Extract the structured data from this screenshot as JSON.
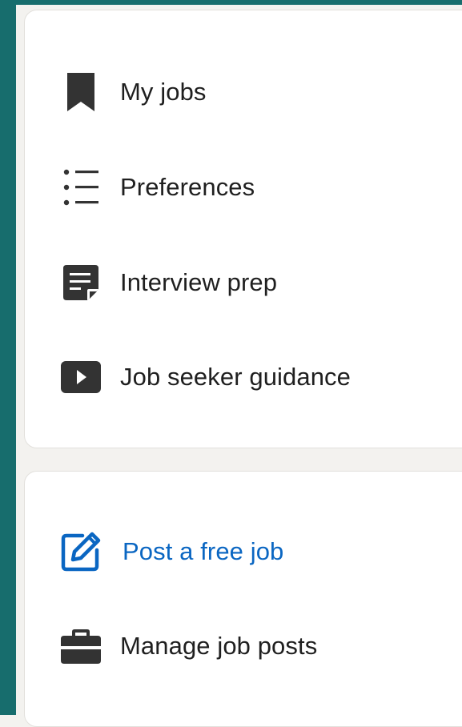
{
  "colors": {
    "accent": "#0a66c2",
    "text": "#1f1f1f",
    "icon": "#333333",
    "sidebar_strip": "#176d6d"
  },
  "nav_primary": {
    "items": [
      {
        "label": "My jobs",
        "icon": "bookmark-icon"
      },
      {
        "label": "Preferences",
        "icon": "list-icon"
      },
      {
        "label": "Interview prep",
        "icon": "note-icon"
      },
      {
        "label": "Job seeker guidance",
        "icon": "video-play-icon"
      }
    ]
  },
  "nav_secondary": {
    "items": [
      {
        "label": "Post a free job",
        "icon": "edit-icon"
      },
      {
        "label": "Manage job posts",
        "icon": "briefcase-icon"
      }
    ]
  }
}
